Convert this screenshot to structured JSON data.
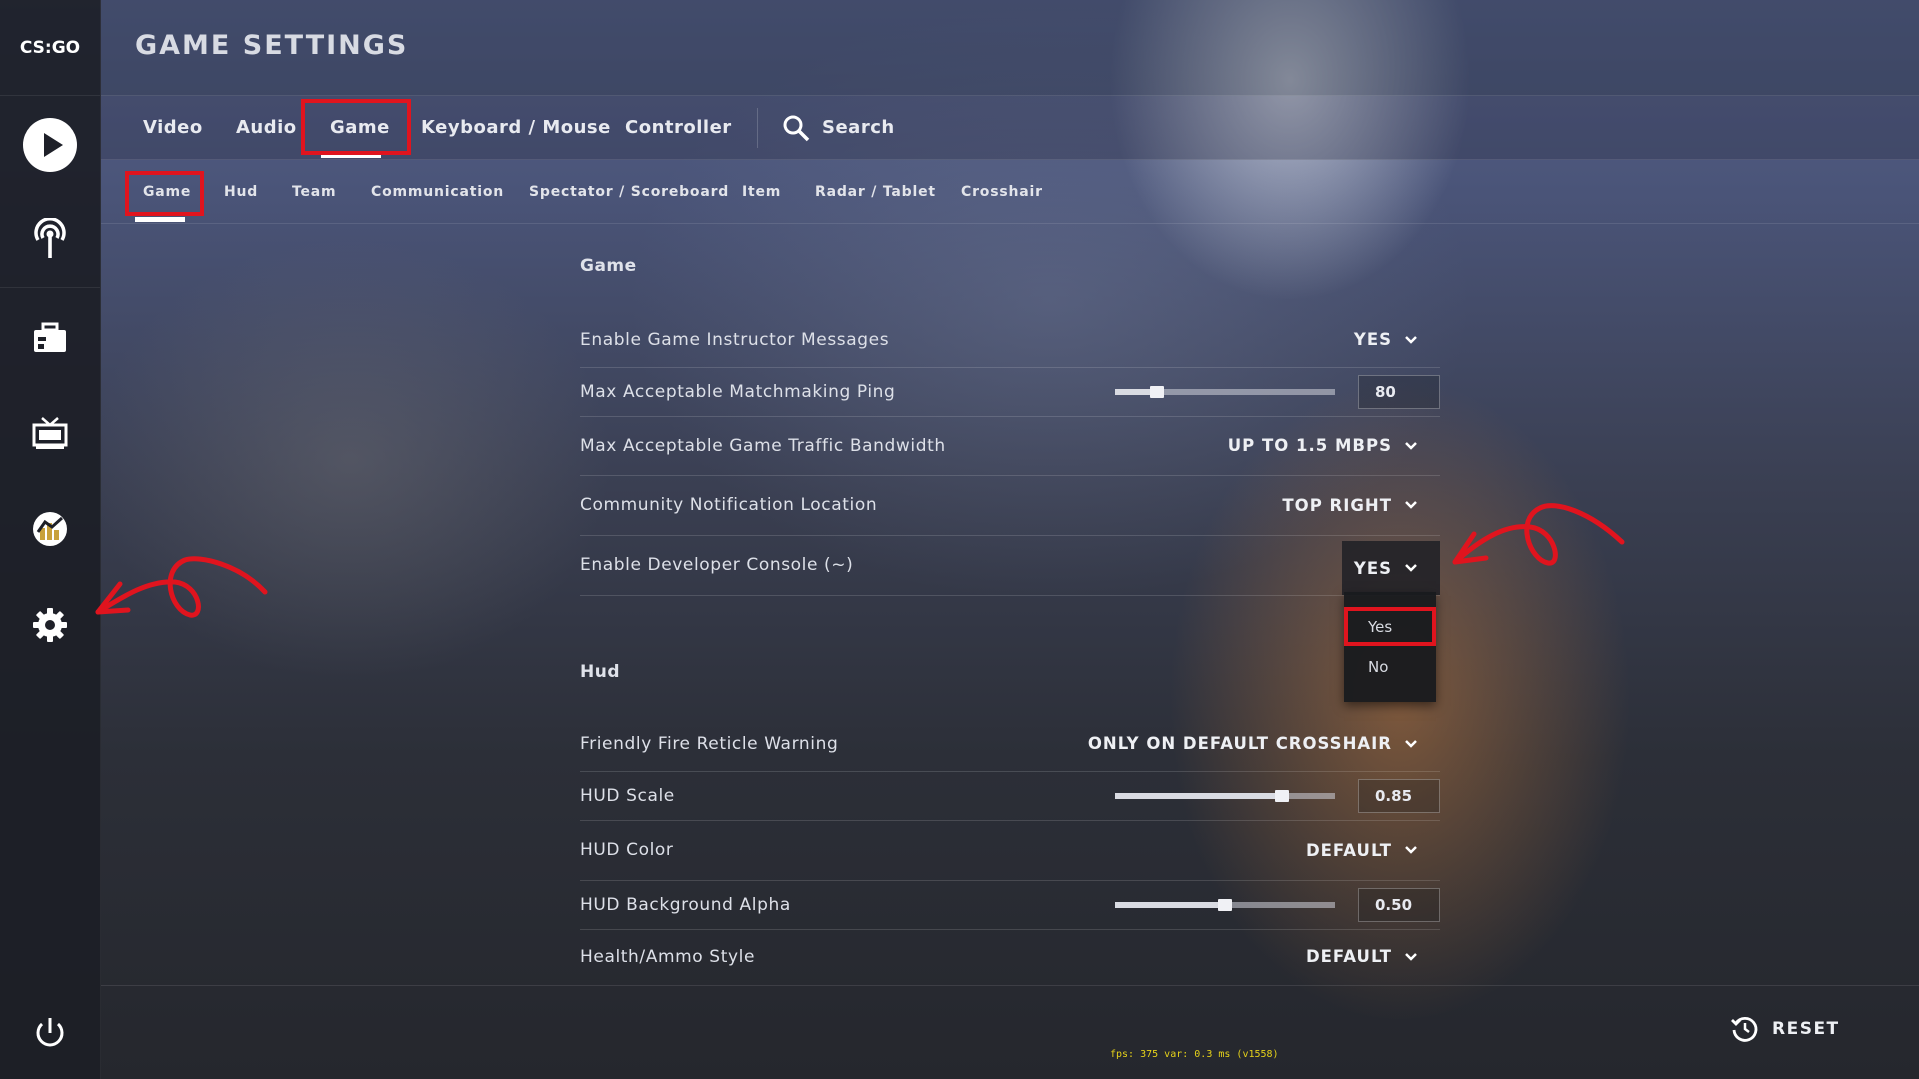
{
  "app": {
    "logo_text": "CS:GO",
    "page_title": "GAME SETTINGS"
  },
  "sidebar": {
    "items": [
      {
        "name": "play",
        "icon": "play-icon"
      },
      {
        "name": "broadcast",
        "icon": "antenna-icon"
      },
      {
        "name": "inventory",
        "icon": "briefcase-icon"
      },
      {
        "name": "watch",
        "icon": "tv-icon"
      },
      {
        "name": "stats",
        "icon": "stats-icon"
      },
      {
        "name": "settings",
        "icon": "gear-icon"
      }
    ],
    "power_icon": "power-icon"
  },
  "tabs": {
    "items": [
      "Video",
      "Audio",
      "Game",
      "Keyboard / Mouse",
      "Controller"
    ],
    "active": "Game",
    "search_label": "Search"
  },
  "subtabs": {
    "items": [
      "Game",
      "Hud",
      "Team",
      "Communication",
      "Spectator / Scoreboard",
      "Item",
      "Radar / Tablet",
      "Crosshair"
    ],
    "active": "Game"
  },
  "sections": {
    "game": {
      "title": "Game",
      "rows": {
        "instructor": {
          "label": "Enable Game Instructor Messages",
          "value": "YES"
        },
        "ping": {
          "label": "Max Acceptable Matchmaking Ping",
          "value": "80",
          "slider_fraction": 0.19
        },
        "bandwidth": {
          "label": "Max Acceptable Game Traffic Bandwidth",
          "value": "UP TO 1.5 MBPS"
        },
        "notif_loc": {
          "label": "Community Notification Location",
          "value": "TOP RIGHT"
        },
        "dev_console": {
          "label": "Enable Developer Console (~)",
          "value": "YES"
        }
      }
    },
    "hud": {
      "title": "Hud",
      "rows": {
        "ff_warning": {
          "label": "Friendly Fire Reticle Warning",
          "value": "ONLY ON DEFAULT CROSSHAIR"
        },
        "hud_scale": {
          "label": "HUD Scale",
          "value": "0.85",
          "slider_fraction": 0.76
        },
        "hud_color": {
          "label": "HUD Color",
          "value": "DEFAULT"
        },
        "hud_alpha": {
          "label": "HUD Background Alpha",
          "value": "0.50",
          "slider_fraction": 0.5
        },
        "health_style": {
          "label": "Health/Ammo Style",
          "value": "DEFAULT"
        }
      }
    }
  },
  "dropdown_menu": {
    "options": [
      "Yes",
      "No"
    ],
    "highlighted": "Yes"
  },
  "footer": {
    "reset_label": "RESET",
    "fps_text": "fps:   375 var:  0.3 ms (v1558)"
  },
  "colors": {
    "annotation_red": "#e0141e",
    "fps_yellow": "#e6d21a"
  }
}
